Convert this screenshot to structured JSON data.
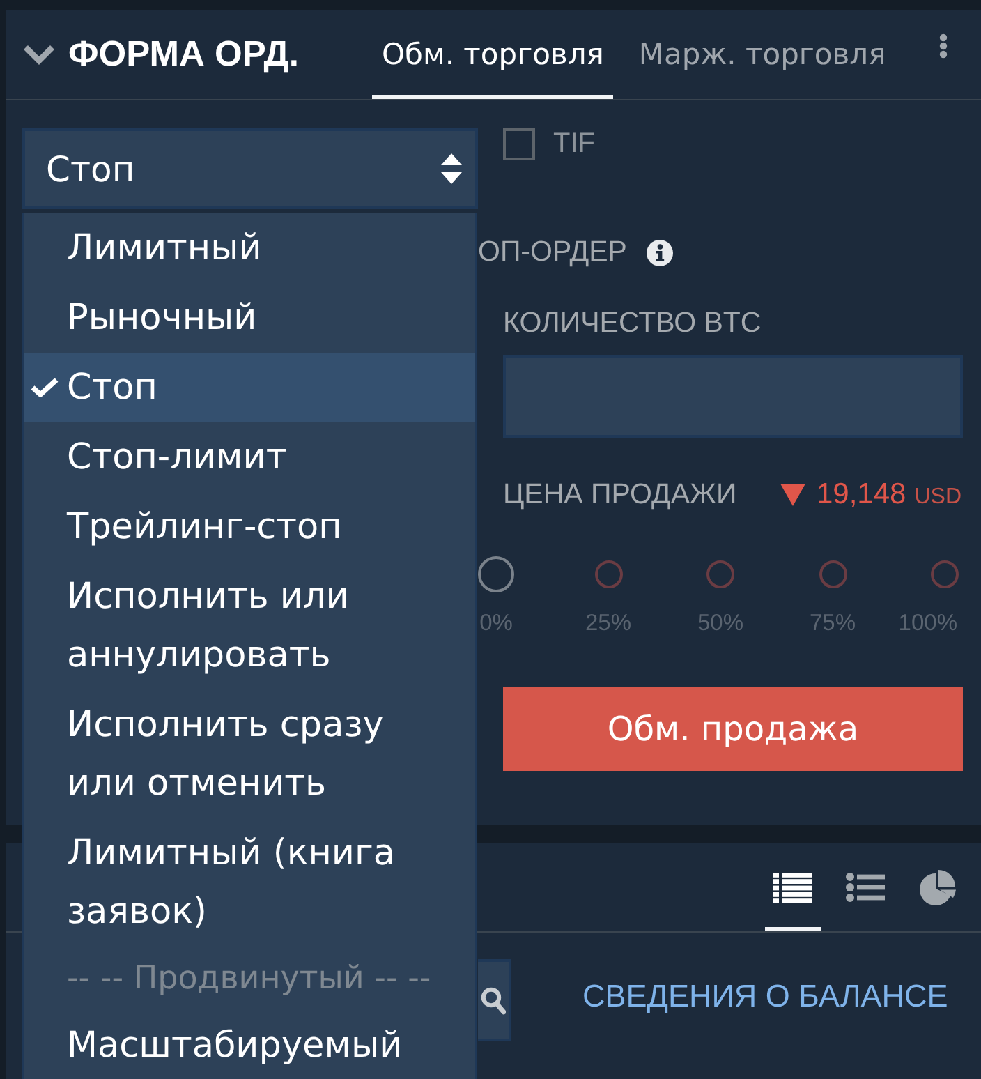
{
  "panel": {
    "title": "ФОРМА ОРД.",
    "expanded": true,
    "tabs": [
      {
        "label": "Обм. торговля",
        "selected": true
      },
      {
        "label": "Марж. торговля",
        "selected": false
      }
    ]
  },
  "order_type": {
    "value": "Стоп",
    "open": true,
    "options": [
      {
        "label": "Лимитный",
        "kind": "option",
        "selected": false
      },
      {
        "label": "Рыночный",
        "kind": "option",
        "selected": false
      },
      {
        "label": "Стоп",
        "kind": "option",
        "selected": true
      },
      {
        "label": "Стоп-лимит",
        "kind": "option",
        "selected": false
      },
      {
        "label": "Трейлинг-стоп",
        "kind": "option",
        "selected": false
      },
      {
        "label": "Исполнить или аннулировать",
        "kind": "option",
        "selected": false
      },
      {
        "label": "Исполнить сразу или отменить",
        "kind": "option",
        "selected": false
      },
      {
        "label": "Лимитный (книга заявок)",
        "kind": "option",
        "selected": false
      },
      {
        "label": "-- -- Продвинутый -- --",
        "kind": "group"
      },
      {
        "label": "Масштабируемый",
        "kind": "option",
        "selected": false
      }
    ]
  },
  "tif": {
    "label": "TIF",
    "checked": false
  },
  "stop_order_label": "ОП-ОРДЕР",
  "quantity": {
    "label": "КОЛИЧЕСТВО BTC"
  },
  "price": {
    "label": "ЦЕНА ПРОДАЖИ",
    "falling": true,
    "value": "19,148",
    "currency": "USD"
  },
  "slider": {
    "level": 0,
    "marks": [
      "0%",
      "25%",
      "50%",
      "75%",
      "100%"
    ]
  },
  "submit": {
    "label": "Обм. продажа"
  },
  "balances": {
    "views": [
      {
        "kind": "table",
        "selected": true
      },
      {
        "kind": "list",
        "selected": false
      },
      {
        "kind": "pie",
        "selected": false
      }
    ],
    "link": "СВЕДЕНИЯ О БАЛАНСЕ"
  }
}
